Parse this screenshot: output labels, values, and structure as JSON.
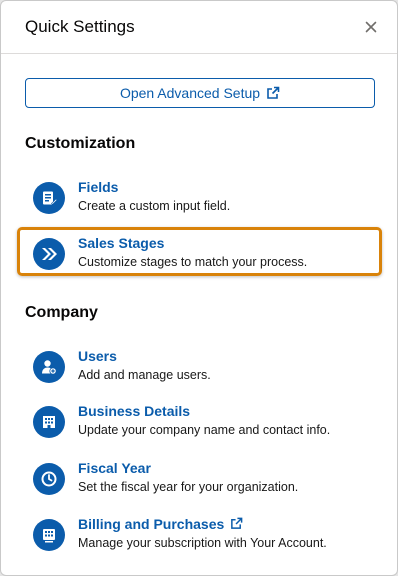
{
  "header": {
    "title": "Quick Settings",
    "close_icon": "close-icon"
  },
  "advanced_button": {
    "label": "Open Advanced Setup",
    "icon": "external-link-icon"
  },
  "sections": {
    "customization": {
      "title": "Customization",
      "items": [
        {
          "title": "Fields",
          "description": "Create a custom input field.",
          "icon": "fields-icon"
        },
        {
          "title": "Sales Stages",
          "description": "Customize stages to match your process.",
          "icon": "chevrons-icon",
          "highlighted": true
        }
      ]
    },
    "company": {
      "title": "Company",
      "items": [
        {
          "title": "Users",
          "description": "Add and manage users.",
          "icon": "add-user-icon"
        },
        {
          "title": "Business Details",
          "description": "Update your company name and contact info.",
          "icon": "building-icon"
        },
        {
          "title": "Fiscal Year",
          "description": "Set the fiscal year for your organization.",
          "icon": "clock-icon"
        },
        {
          "title": "Billing and Purchases",
          "description": "Manage your subscription with Your Account.",
          "icon": "billing-icon",
          "external": true
        }
      ]
    }
  },
  "colors": {
    "accent": "#0b5cab",
    "highlight": "#d9830a"
  }
}
